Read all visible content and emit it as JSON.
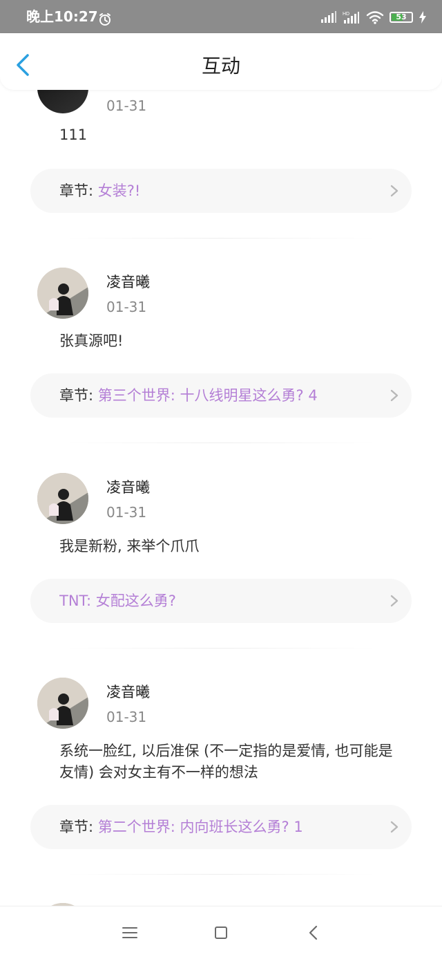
{
  "status_bar": {
    "time": "晚上10:27",
    "battery": "53"
  },
  "header": {
    "title": "互动"
  },
  "items": [
    {
      "date": "01-31",
      "comment": "111",
      "chapter_prefix": "章节: ",
      "chapter_title": "女装?!"
    },
    {
      "username": "凌音曦",
      "date": "01-31",
      "comment": "张真源吧!",
      "chapter_prefix": "章节: ",
      "chapter_title": "第三个世界: 十八线明星这么勇? 4"
    },
    {
      "username": "凌音曦",
      "date": "01-31",
      "comment": "我是新粉, 来举个爪爪",
      "chapter_prefix": "",
      "chapter_title": "TNT: 女配这么勇?"
    },
    {
      "username": "凌音曦",
      "date": "01-31",
      "comment": "系统一脸红, 以后准保 (不一定指的是爱情, 也可能是友情) 会对女主有不一样的想法",
      "chapter_prefix": "章节: ",
      "chapter_title": "第二个世界: 内向班长这么勇? 1"
    }
  ]
}
